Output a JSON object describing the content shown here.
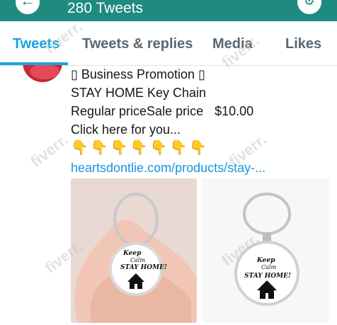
{
  "header": {
    "title": "280 Tweets",
    "back_icon": "arrow-left-icon",
    "settings_icon": "gear-icon"
  },
  "tabs": [
    {
      "label": "Tweets",
      "active": true
    },
    {
      "label": "Tweets & replies",
      "active": false
    },
    {
      "label": "Media",
      "active": false
    },
    {
      "label": "Likes",
      "active": false
    }
  ],
  "tweet": {
    "line1": "▯ Business Promotion ▯",
    "line2": "STAY HOME Key Chain",
    "line3": "Regular priceSale price",
    "price": "$10.00",
    "line4": "Click here for you...",
    "emoji_row": "👇👇👇👇👇👇👇",
    "link": "heartsdontlie.com/products/stay-..."
  },
  "media": {
    "image1_caption": [
      "Keep",
      "Calm",
      "STAY HOME!"
    ],
    "image2_caption": [
      "Keep",
      "Calm",
      "STAY HOME!"
    ]
  },
  "watermark": "fiverr.",
  "colors": {
    "header_bg": "#1e8a80",
    "accent": "#1ba1e2",
    "link": "#1b95e0",
    "emoji": "#d83b86"
  }
}
